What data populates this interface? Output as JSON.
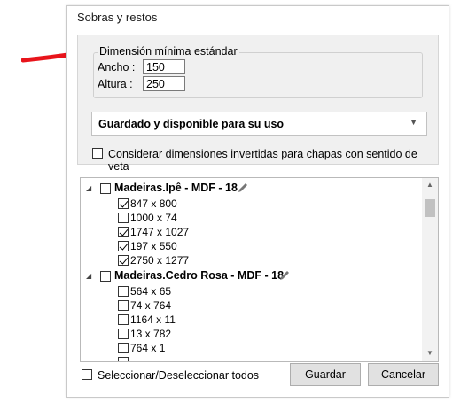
{
  "dialog": {
    "title": "Sobras y restos"
  },
  "group": {
    "legend": "Dimensión mínima estándar",
    "ancho_label": "Ancho :",
    "ancho_value": "150",
    "altura_label": "Altura :",
    "altura_value": "250"
  },
  "status_combo": {
    "selected": "Guardado y disponible para su uso"
  },
  "invert_option": {
    "label": "Considerar dimensiones invertidas para chapas con sentido de veta",
    "checked": false
  },
  "tree": {
    "groups": [
      {
        "label": "Madeiras.Ipê - MDF - 18",
        "checked": false,
        "items": [
          {
            "label": "847 x 800",
            "checked": true
          },
          {
            "label": "1000 x 74",
            "checked": false
          },
          {
            "label": "1747 x 1027",
            "checked": true
          },
          {
            "label": "197 x 550",
            "checked": true
          },
          {
            "label": "2750 x 1277",
            "checked": true
          }
        ]
      },
      {
        "label": "Madeiras.Cedro Rosa - MDF - 18",
        "checked": false,
        "items": [
          {
            "label": "564 x 65",
            "checked": false
          },
          {
            "label": "74 x 764",
            "checked": false
          },
          {
            "label": "1164 x 11",
            "checked": false
          },
          {
            "label": "13 x 782",
            "checked": false
          },
          {
            "label": "764 x 1",
            "checked": false
          }
        ]
      }
    ]
  },
  "footer": {
    "select_all_label": "Seleccionar/Deseleccionar todos",
    "save_label": "Guardar",
    "cancel_label": "Cancelar"
  },
  "colors": {
    "annotation_arrow": "#e8141b",
    "dialog_panel": "#f0f0f0",
    "button": "#e1e1e1"
  }
}
